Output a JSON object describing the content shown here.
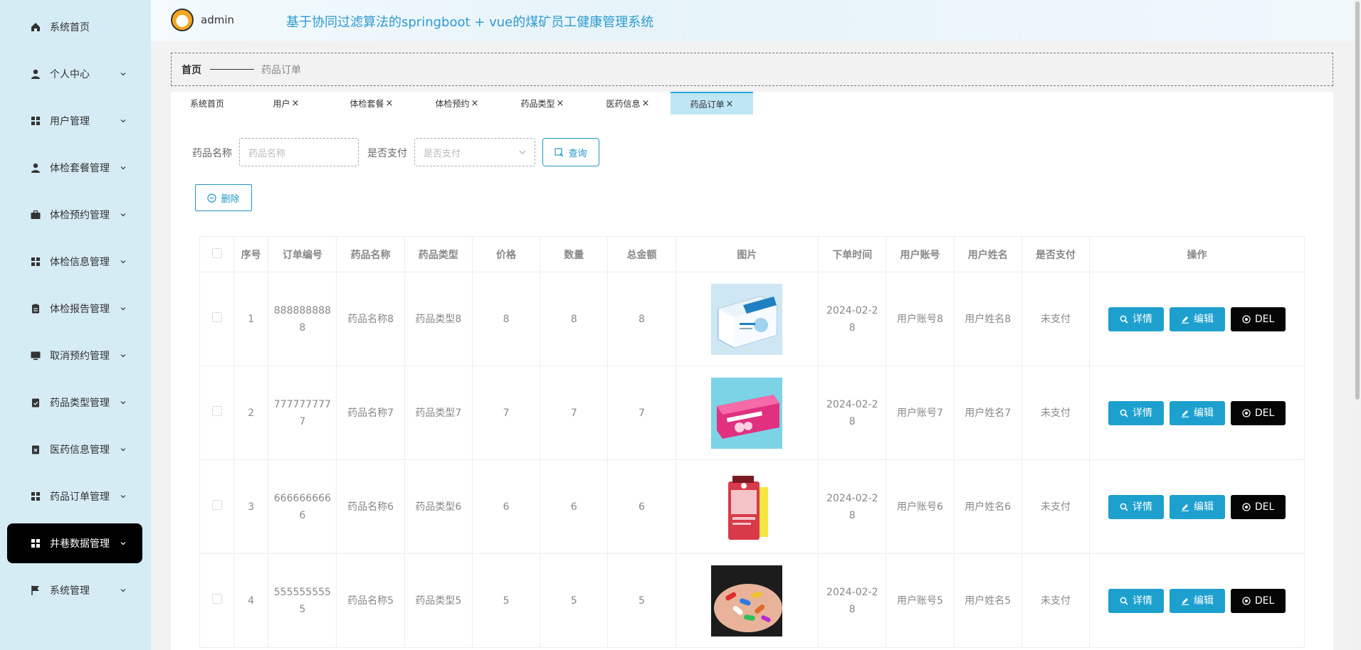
{
  "header": {
    "username": "admin",
    "title": "基于协同过滤算法的springboot + vue的煤矿员工健康管理系统"
  },
  "sidebar": {
    "items": [
      {
        "label": "系统首页",
        "icon": "home-icon"
      },
      {
        "label": "个人中心",
        "icon": "user-icon"
      },
      {
        "label": "用户管理",
        "icon": "grid-icon"
      },
      {
        "label": "体检套餐管理",
        "icon": "user-icon"
      },
      {
        "label": "体检预约管理",
        "icon": "briefcase-icon"
      },
      {
        "label": "体检信息管理",
        "icon": "grid-icon"
      },
      {
        "label": "体检报告管理",
        "icon": "clipboard-icon"
      },
      {
        "label": "取消预约管理",
        "icon": "monitor-icon"
      },
      {
        "label": "药品类型管理",
        "icon": "check-clipboard-icon"
      },
      {
        "label": "医药信息管理",
        "icon": "x-clipboard-icon"
      },
      {
        "label": "药品订单管理",
        "icon": "grid-icon"
      },
      {
        "label": "井巷数据管理",
        "icon": "grid-icon"
      },
      {
        "label": "系统管理",
        "icon": "flag-icon"
      }
    ],
    "active_index": 11
  },
  "breadcrumb": {
    "home": "首页",
    "current": "药品订单"
  },
  "tabs": [
    {
      "label": "系统首页",
      "closable": false
    },
    {
      "label": "用户",
      "closable": true
    },
    {
      "label": "体检套餐",
      "closable": true
    },
    {
      "label": "体检预约",
      "closable": true
    },
    {
      "label": "药品类型",
      "closable": true
    },
    {
      "label": "医药信息",
      "closable": true
    },
    {
      "label": "药品订单",
      "closable": true
    }
  ],
  "tab_close_glyph": "×",
  "search": {
    "name_label": "药品名称",
    "name_placeholder": "药品名称",
    "paid_label": "是否支付",
    "paid_placeholder": "是否支付",
    "query_label": "查询"
  },
  "actions": {
    "delete_label": "删除"
  },
  "table": {
    "headers": [
      "序号",
      "订单编号",
      "药品名称",
      "药品类型",
      "价格",
      "数量",
      "总金额",
      "图片",
      "下单时间",
      "用户账号",
      "用户姓名",
      "是否支付",
      "操作"
    ],
    "rows": [
      {
        "index": "1",
        "order_no_1": "888888888",
        "order_no_2": "8",
        "name": "药品名称8",
        "type": "药品类型8",
        "price": "8",
        "qty": "8",
        "total": "8",
        "image": "blue-white-medicine-box",
        "time_1": "2024-02-2",
        "time_2": "8",
        "account": "用户账号8",
        "user": "用户姓名8",
        "paid": "未支付"
      },
      {
        "index": "2",
        "order_no_1": "777777777",
        "order_no_2": "7",
        "name": "药品名称7",
        "type": "药品类型7",
        "price": "7",
        "qty": "7",
        "total": "7",
        "image": "pink-medicine-box",
        "time_1": "2024-02-2",
        "time_2": "8",
        "account": "用户账号7",
        "user": "用户姓名7",
        "paid": "未支付"
      },
      {
        "index": "3",
        "order_no_1": "666666666",
        "order_no_2": "6",
        "name": "药品名称6",
        "type": "药品类型6",
        "price": "6",
        "qty": "6",
        "total": "6",
        "image": "red-syrup-bottle",
        "time_1": "2024-02-2",
        "time_2": "8",
        "account": "用户账号6",
        "user": "用户姓名6",
        "paid": "未支付"
      },
      {
        "index": "4",
        "order_no_1": "555555555",
        "order_no_2": "5",
        "name": "药品名称5",
        "type": "药品类型5",
        "price": "5",
        "qty": "5",
        "total": "5",
        "image": "pills-in-hand",
        "time_1": "2024-02-2",
        "time_2": "8",
        "account": "用户账号5",
        "user": "用户姓名5",
        "paid": "未支付"
      }
    ],
    "op_labels": {
      "detail": "详情",
      "edit": "编辑",
      "del": "DEL"
    }
  },
  "colors": {
    "sidebar_bg": "#d6ecf5",
    "accent": "#1ea0cf",
    "active_menu": "#000000",
    "title": "#2e9bd1"
  }
}
